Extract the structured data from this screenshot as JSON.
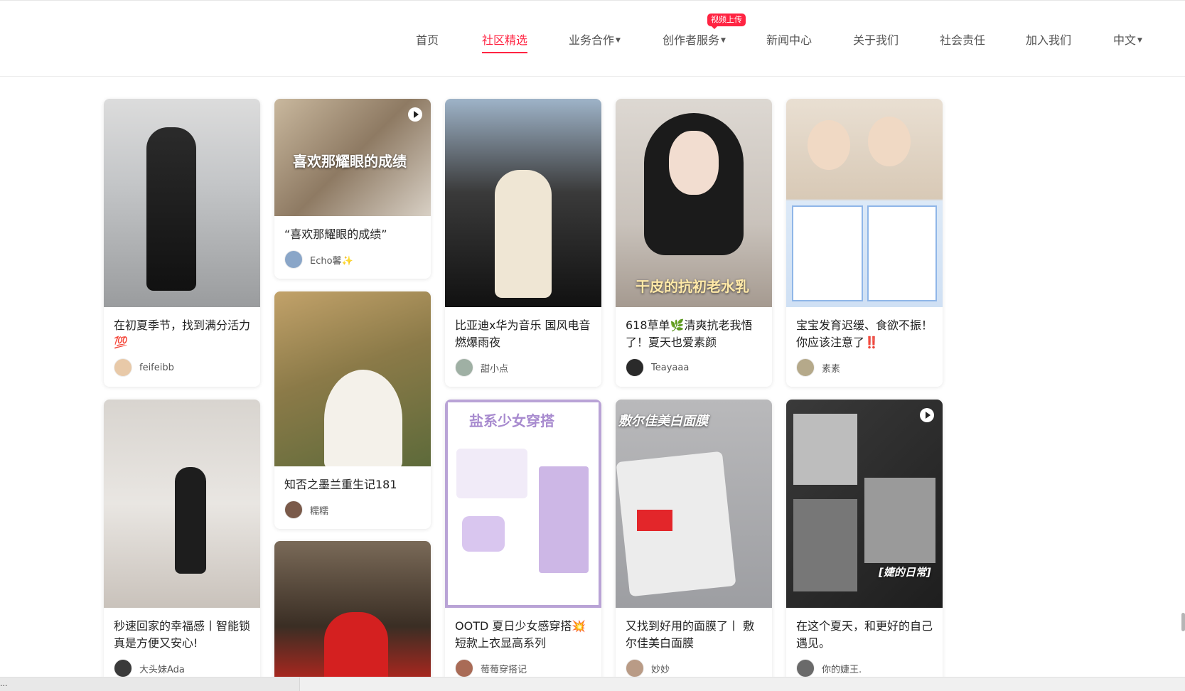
{
  "nav": {
    "items": [
      {
        "label": "首页",
        "dropdown": false,
        "active": false
      },
      {
        "label": "社区精选",
        "dropdown": false,
        "active": true
      },
      {
        "label": "业务合作",
        "dropdown": true,
        "active": false
      },
      {
        "label": "创作者服务",
        "dropdown": true,
        "active": false,
        "badge": "视频上传"
      },
      {
        "label": "新闻中心",
        "dropdown": false,
        "active": false
      },
      {
        "label": "关于我们",
        "dropdown": false,
        "active": false
      },
      {
        "label": "社会责任",
        "dropdown": false,
        "active": false
      },
      {
        "label": "加入我们",
        "dropdown": false,
        "active": false
      },
      {
        "label": "中文",
        "dropdown": true,
        "active": false
      }
    ]
  },
  "colors": {
    "accent": "#ff2442",
    "background": "#ffffff"
  },
  "cards": [
    {
      "title": "在初夏季节，找到满分活力💯",
      "author": "feifeibb",
      "video": false,
      "overlay": ""
    },
    {
      "title": "“喜欢那耀眼的成绩”",
      "author": "Echo馨✨",
      "video": true,
      "overlay": "喜欢那耀眼的成绩"
    },
    {
      "title": "知否之墨兰重生记181",
      "author": "糯糯",
      "video": false,
      "overlay": ""
    },
    {
      "title": "",
      "author": "",
      "video": false,
      "overlay": ""
    },
    {
      "title": "比亚迪x华为音乐 国风电音燃爆雨夜",
      "author": "甜小点",
      "video": false,
      "overlay": ""
    },
    {
      "title": "OOTD 夏日少女感穿搭💥短款上衣显高系列",
      "author": "莓莓穿搭记",
      "video": false,
      "overlay": "盐系少女穿搭"
    },
    {
      "title": "618草单🌿清爽抗老我悟了！夏天也爱素颜",
      "author": "Teayaaa",
      "video": false,
      "overlay": "干皮的抗初老水乳"
    },
    {
      "title": "又找到好用的面膜了丨 敷尔佳美白面膜",
      "author": "妙妙",
      "video": false,
      "overlay": "敷尔佳美白面膜"
    },
    {
      "title": "宝宝发育迟缓、食欲不振！你应该注意了‼️",
      "author": "素素",
      "video": false,
      "overlay": ""
    },
    {
      "title": "在这个夏天，和更好的自己遇见。",
      "author": "你的婕王.",
      "video": true,
      "overlay": "[婕的日常]"
    },
    {
      "title": "秒速回家的幸福感丨智能锁真是方便又安心!",
      "author": "大头妹Ada",
      "video": false,
      "overlay": ""
    }
  ],
  "status": {
    "text": "..."
  }
}
